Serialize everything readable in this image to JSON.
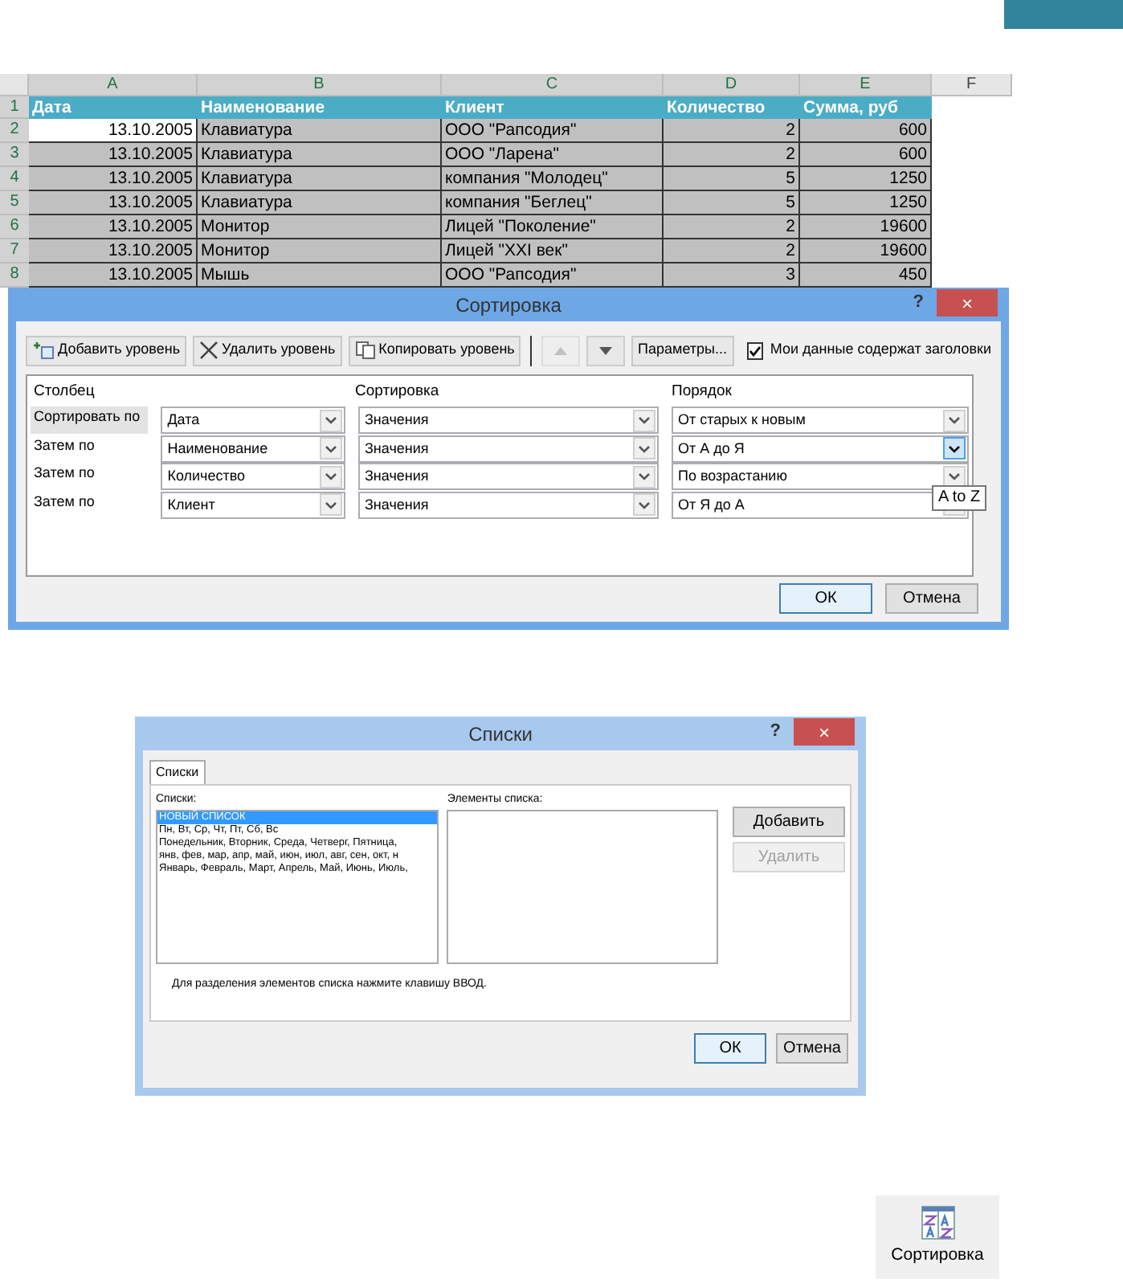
{
  "spreadsheet": {
    "column_letters": [
      "A",
      "B",
      "C",
      "D",
      "E",
      "F"
    ],
    "header": [
      "Дата",
      "Наименование",
      "Клиент",
      "Количество",
      "Сумма, руб"
    ],
    "rows": [
      {
        "number": "1",
        "kind": "header"
      },
      {
        "number": "2",
        "kind": "data",
        "selected": true,
        "cells": [
          "13.10.2005",
          "Клавиатура",
          "ООО \"Рапсодия\"",
          "2",
          "600"
        ]
      },
      {
        "number": "3",
        "kind": "data",
        "selected": false,
        "cells": [
          "13.10.2005",
          "Клавиатура",
          "ООО \"Ларена\"",
          "2",
          "600"
        ]
      },
      {
        "number": "4",
        "kind": "data",
        "selected": false,
        "cells": [
          "13.10.2005",
          "Клавиатура",
          "компания \"Молодец\"",
          "5",
          "1250"
        ]
      },
      {
        "number": "5",
        "kind": "data",
        "selected": false,
        "cells": [
          "13.10.2005",
          "Клавиатура",
          "компания \"Беглец\"",
          "5",
          "1250"
        ]
      },
      {
        "number": "6",
        "kind": "data",
        "selected": false,
        "cells": [
          "13.10.2005",
          "Монитор",
          "Лицей \"Поколение\"",
          "2",
          "19600"
        ]
      },
      {
        "number": "7",
        "kind": "data",
        "selected": false,
        "cells": [
          "13.10.2005",
          "Монитор",
          "Лицей \"XXI век\"",
          "2",
          "19600"
        ]
      },
      {
        "number": "8",
        "kind": "data",
        "selected": false,
        "cells": [
          "13.10.2005",
          "Мышь",
          "ООО \"Рапсодия\"",
          "3",
          "450"
        ]
      }
    ]
  },
  "sort_dialog": {
    "title": "Сортировка",
    "help": "?",
    "close": "×",
    "toolbar": [
      {
        "kind": "add",
        "label": "Добавить уровень"
      },
      {
        "kind": "delete",
        "label": "Удалить уровень"
      },
      {
        "kind": "copy",
        "label": "Копировать уровень"
      }
    ],
    "move_up": {
      "disabled": true
    },
    "move_down": {
      "disabled": false
    },
    "options_button": "Параметры...",
    "headers_checkbox": {
      "label": "Мои данные содержат заголовки",
      "checked": true
    },
    "columns": [
      "Столбец",
      "Сортировка",
      "Порядок"
    ],
    "levels": [
      {
        "label": "Сортировать по",
        "selected": true,
        "column": "Дата",
        "sort_on": "Значения",
        "order": "От старых к новым",
        "hovered": false
      },
      {
        "label": "Затем по",
        "selected": false,
        "column": "Наименование",
        "sort_on": "Значения",
        "order": "От А до Я",
        "hovered": true
      },
      {
        "label": "Затем по",
        "selected": false,
        "column": "Количество",
        "sort_on": "Значения",
        "order": "По возрастанию",
        "hovered": false
      },
      {
        "label": "Затем по",
        "selected": false,
        "column": "Клиент",
        "sort_on": "Значения",
        "order": "От Я до А",
        "hovered": false
      }
    ],
    "tooltip": "A to Z",
    "buttons": [
      "ОК",
      "Отмена"
    ]
  },
  "lists_dialog": {
    "title": "Списки",
    "help": "?",
    "close": "×",
    "tab": "Списки",
    "lists_label": "Списки:",
    "lists": [
      {
        "text": "НОВЫЙ СПИСОК",
        "selected": true
      },
      {
        "text": "Пн, Вт, Ср, Чт, Пт, Сб, Вс",
        "selected": false
      },
      {
        "text": "Понедельник, Вторник, Среда, Четверг, Пятница,",
        "selected": false
      },
      {
        "text": "янв, фев, мар, апр, май, июн, июл, авг, сен, окт, н",
        "selected": false
      },
      {
        "text": "Январь, Февраль, Март, Апрель, Май, Июнь, Июль,",
        "selected": false
      }
    ],
    "entries_label": "Элементы списка:",
    "side_buttons": [
      {
        "label": "Добавить",
        "disabled": false
      },
      {
        "label": "Удалить",
        "disabled": true
      }
    ],
    "hint": "Для разделения элементов списка нажмите клавишу ВВОД.",
    "buttons": [
      "ОК",
      "Отмена"
    ]
  },
  "ribbon_button": {
    "label": "Сортировка"
  }
}
